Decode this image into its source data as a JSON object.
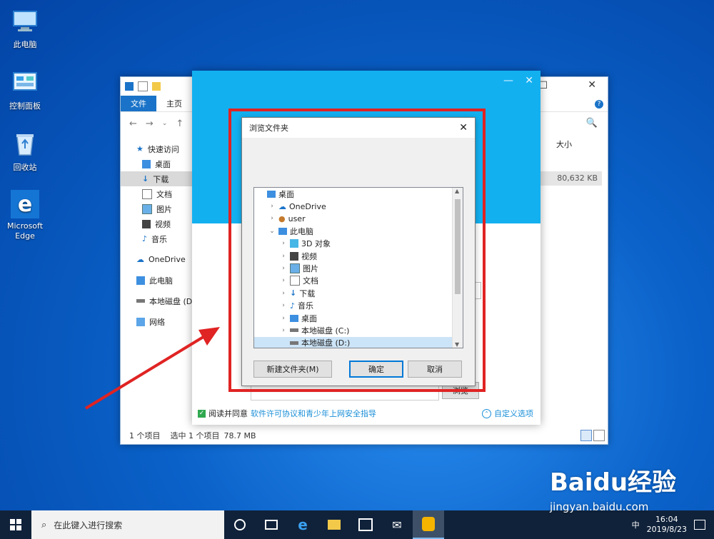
{
  "desktop": {
    "icons": [
      {
        "label": "此电脑"
      },
      {
        "label": "控制面板"
      },
      {
        "label": "回收站"
      },
      {
        "label": "Microsoft Edge"
      }
    ]
  },
  "explorer": {
    "ribbon_tabs": [
      "文件",
      "主页"
    ],
    "search_icon": "🔍",
    "column_size": "大小",
    "file_size": "80,632 KB",
    "nav": {
      "quick_access": "快速访问",
      "desktop": "桌面",
      "downloads": "下载",
      "documents": "文档",
      "pictures": "图片",
      "videos": "视频",
      "music": "音乐",
      "onedrive": "OneDrive",
      "this_pc": "此电脑",
      "local_disk_d": "本地磁盘 (D:)",
      "network": "网络"
    },
    "status": {
      "item_count": "1 个项目",
      "selected": "选中 1 个项目",
      "size": "78.7 MB"
    }
  },
  "installer": {
    "agree_text": "阅读并同意",
    "agree_link": "软件许可协议和青少年上网安全指导",
    "custom_options": "自定义选项",
    "browse_partial": "浏览"
  },
  "dialog": {
    "title": "浏览文件夹",
    "tree": [
      {
        "label": "桌面",
        "level": 0,
        "chevron": "",
        "icon": "desktop"
      },
      {
        "label": "OneDrive",
        "level": 1,
        "chevron": "›",
        "icon": "cloud"
      },
      {
        "label": "user",
        "level": 1,
        "chevron": "›",
        "icon": "user"
      },
      {
        "label": "此电脑",
        "level": 1,
        "chevron": "⌄",
        "icon": "pc"
      },
      {
        "label": "3D 对象",
        "level": 2,
        "chevron": "›",
        "icon": "cube"
      },
      {
        "label": "视频",
        "level": 2,
        "chevron": "›",
        "icon": "video"
      },
      {
        "label": "图片",
        "level": 2,
        "chevron": "›",
        "icon": "picture"
      },
      {
        "label": "文档",
        "level": 2,
        "chevron": "›",
        "icon": "document"
      },
      {
        "label": "下载",
        "level": 2,
        "chevron": "›",
        "icon": "download"
      },
      {
        "label": "音乐",
        "level": 2,
        "chevron": "›",
        "icon": "music"
      },
      {
        "label": "桌面",
        "level": 2,
        "chevron": "›",
        "icon": "desktop"
      },
      {
        "label": "本地磁盘 (C:)",
        "level": 2,
        "chevron": "›",
        "icon": "disk"
      },
      {
        "label": "本地磁盘 (D:)",
        "level": 2,
        "chevron": "",
        "icon": "disk",
        "selected": true
      }
    ],
    "new_folder": "新建文件夹(M)",
    "ok": "确定",
    "cancel": "取消"
  },
  "taskbar": {
    "search_placeholder": "在此键入进行搜索",
    "ime": "中",
    "time": "16:04",
    "date": "2019/8/23"
  },
  "watermark": {
    "brand": "Baidu经验",
    "url": "jingyan.baidu.com"
  },
  "colors": {
    "accent": "#0078d7",
    "installer_header": "#13b0f0",
    "annotation_red": "#e02323"
  }
}
